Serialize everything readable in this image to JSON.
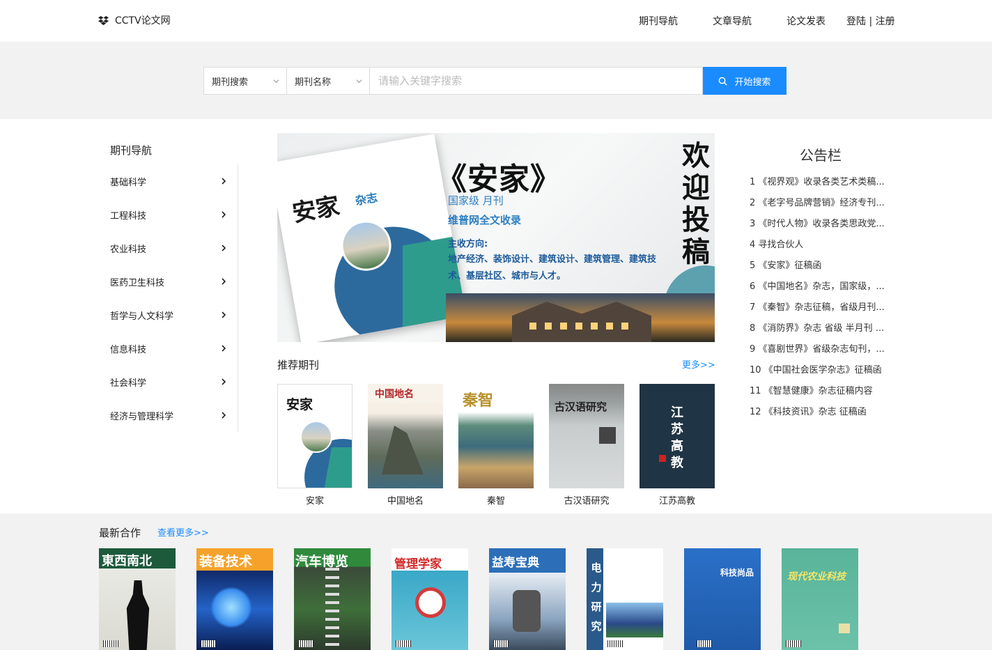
{
  "header": {
    "logo_text": "CCTV论文网",
    "nav": [
      "期刊导航",
      "文章导航",
      "论文发表",
      "登陆 | 注册"
    ]
  },
  "search": {
    "type_select": "期刊搜索",
    "field_select": "期刊名称",
    "placeholder": "请输入关键字搜索",
    "button_label": "开始搜索"
  },
  "sidebar": {
    "title": "期刊导航",
    "items": [
      "基础科学",
      "工程科技",
      "农业科技",
      "医药卫生科技",
      "哲学与人文科学",
      "信息科技",
      "社会科学",
      "经济与管理科学"
    ]
  },
  "banner": {
    "cover_title": "安家",
    "cover_sub": "杂志",
    "title": "《安家》",
    "line1": "国家级 月刊",
    "line2": "维普网全文收录",
    "line3": "主收方向:",
    "line4": "地产经济、装饰设计、建筑设计、建筑管理、建筑技术、基层社区、城市与人才。",
    "welcome": "欢迎投稿"
  },
  "recommended": {
    "title": "推荐期刊",
    "more": "更多>>",
    "items": [
      "安家",
      "中国地名",
      "秦智",
      "古汉语研究",
      "江苏高教"
    ],
    "cover_texts": [
      "安家",
      "中国地名",
      "秦智",
      "古汉语研究",
      "江苏高教"
    ]
  },
  "notice": {
    "title": "公告栏",
    "items": [
      "1 《视界观》收录各类艺术类稿...",
      "2 《老字号品牌营销》经济专刊...",
      "3 《时代人物》收录各类思政党...",
      "4 寻找合伙人",
      "5 《安家》征稿函",
      "6 《中国地名》杂志，国家级，...",
      "7 《秦智》杂志征稿，省级月刊...",
      "8 《消防界》杂志 省级 半月刊 ...",
      "9 《喜剧世界》省级杂志旬刊，...",
      "10 《中国社会医学杂志》征稿函",
      "11 《智慧健康》杂志征稿内容",
      "12 《科技资讯》杂志 征稿函"
    ]
  },
  "cooperation": {
    "title": "最新合作",
    "more": "查看更多>>",
    "cover_texts": [
      "東西南北",
      "装备技术",
      "汽车博览",
      "管理学家",
      "益寿宝典",
      "电力研究",
      "科技尚品",
      "现代农业科技"
    ]
  },
  "colors": {
    "accent": "#1a8cff",
    "band_gray": "#f2f2f2"
  }
}
